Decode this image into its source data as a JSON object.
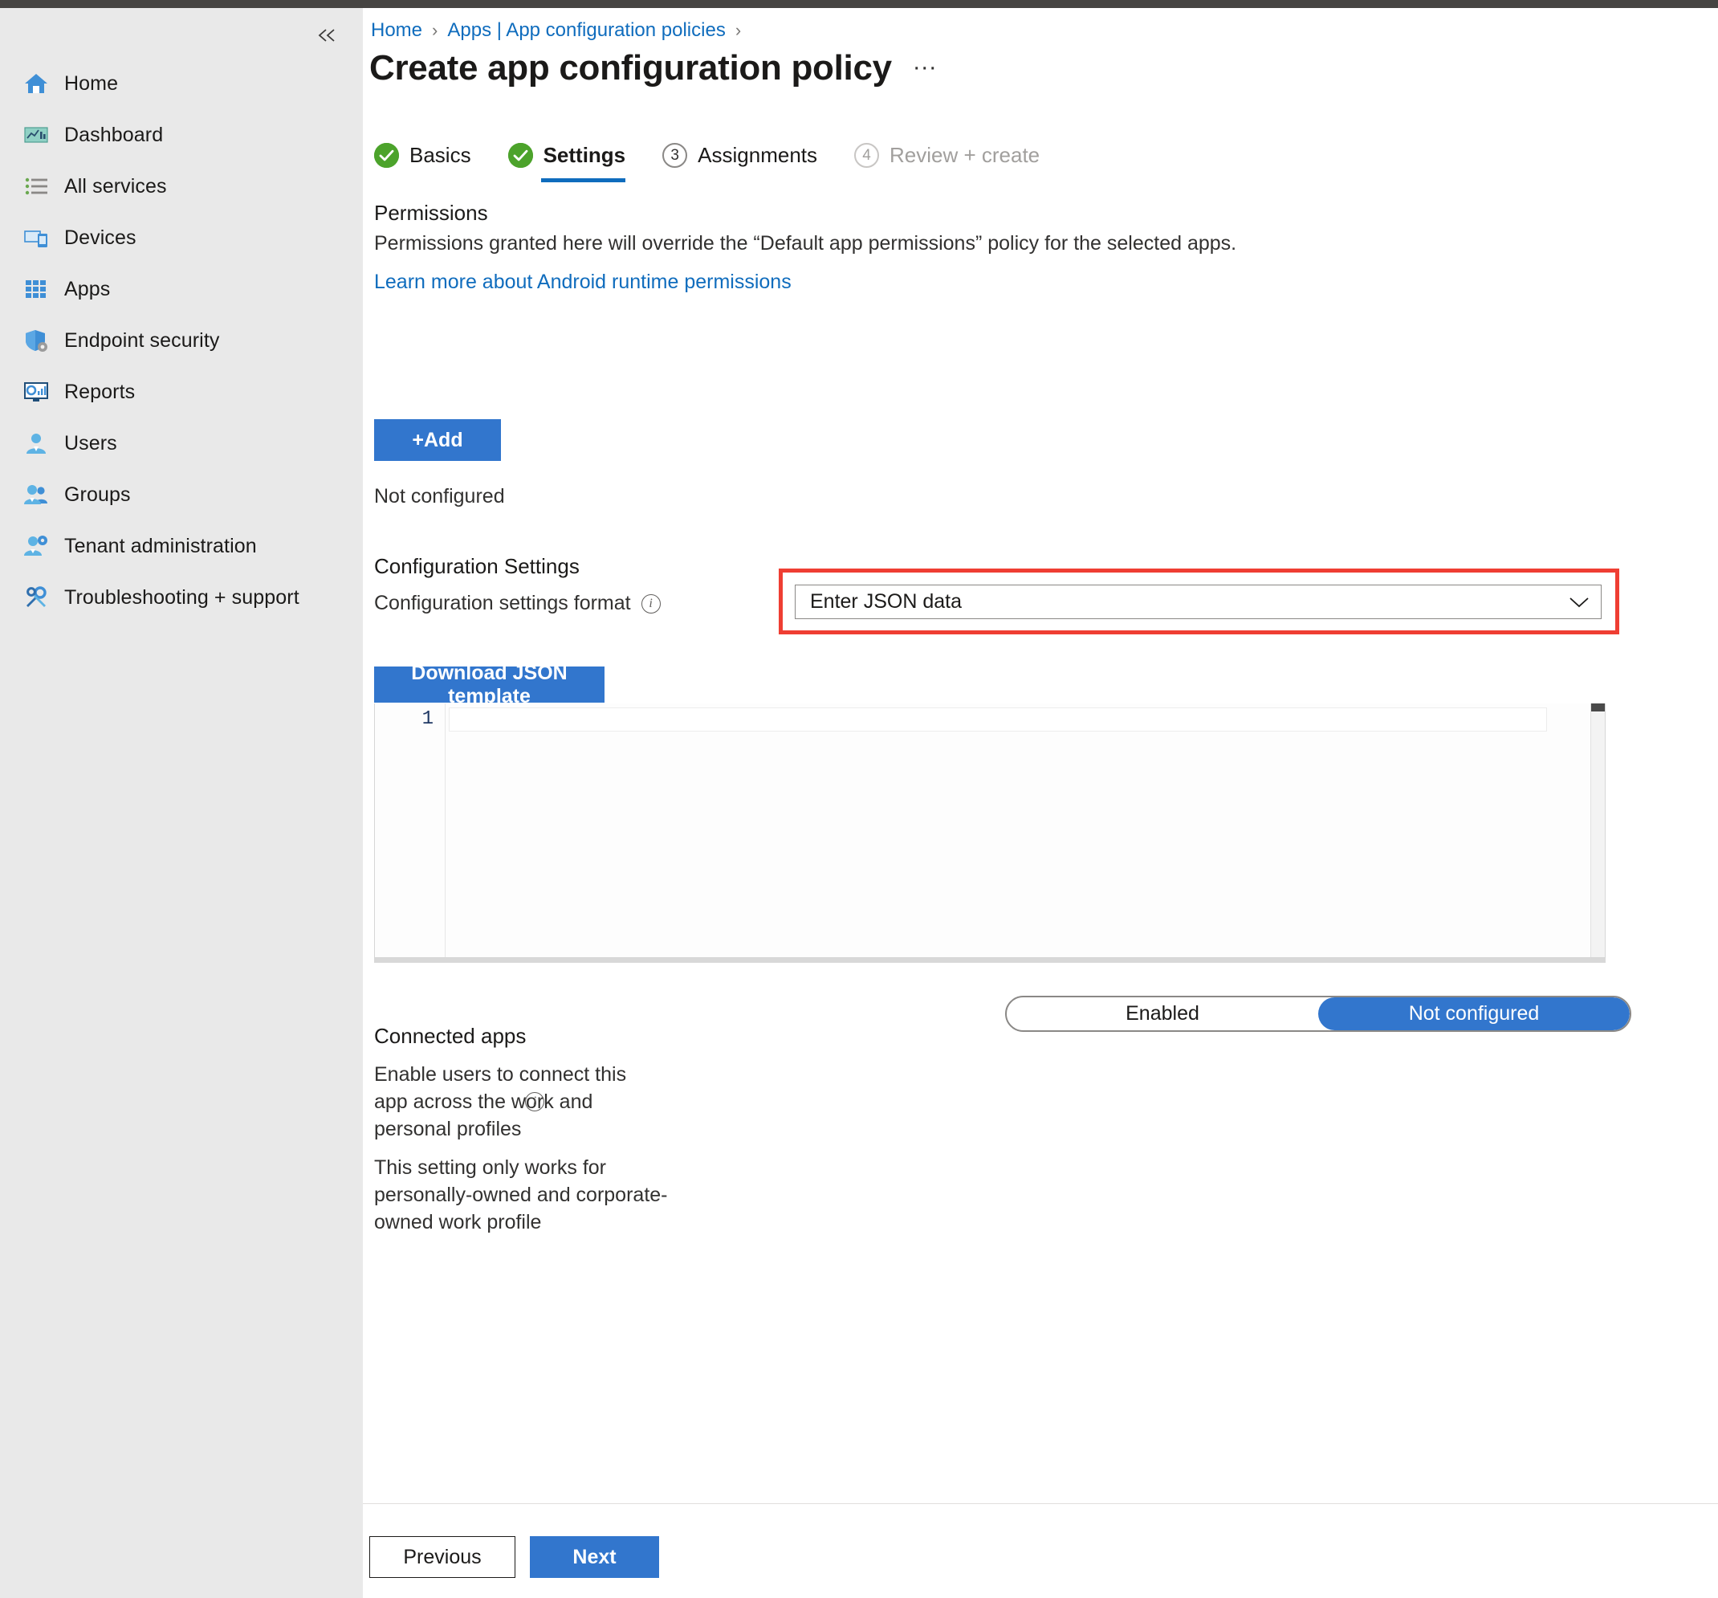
{
  "sidebar": {
    "collapse_label": "«",
    "items": [
      {
        "label": "Home",
        "icon": "home-icon"
      },
      {
        "label": "Dashboard",
        "icon": "dashboard-icon"
      },
      {
        "label": "All services",
        "icon": "all-services-icon"
      },
      {
        "label": "Devices",
        "icon": "devices-icon"
      },
      {
        "label": "Apps",
        "icon": "apps-grid-icon"
      },
      {
        "label": "Endpoint security",
        "icon": "shield-gear-icon"
      },
      {
        "label": "Reports",
        "icon": "reports-monitor-icon"
      },
      {
        "label": "Users",
        "icon": "user-icon"
      },
      {
        "label": "Groups",
        "icon": "groups-icon"
      },
      {
        "label": "Tenant administration",
        "icon": "tenant-admin-icon"
      },
      {
        "label": "Troubleshooting + support",
        "icon": "wrench-screwdriver-icon"
      }
    ]
  },
  "breadcrumb": {
    "items": [
      "Home",
      "Apps | App configuration policies"
    ],
    "separator": "›"
  },
  "header": {
    "title": "Create app configuration policy",
    "more_label": "···"
  },
  "wizard": {
    "steps": [
      {
        "label": "Basics",
        "marker": "✓",
        "state": "done"
      },
      {
        "label": "Settings",
        "marker": "✓",
        "state": "active"
      },
      {
        "label": "Assignments",
        "marker": "3",
        "state": "upcoming"
      },
      {
        "label": "Review + create",
        "marker": "4",
        "state": "disabled"
      }
    ]
  },
  "permissions": {
    "heading": "Permissions",
    "description": "Permissions granted here will override the “Default app permissions” policy for the selected apps.",
    "learn_more": "Learn more about Android runtime permissions",
    "add_button": "+Add",
    "status": "Not configured"
  },
  "configuration_settings": {
    "heading": "Configuration Settings",
    "format_label": "Configuration settings format",
    "format_info": "i",
    "format_value": "Enter JSON data",
    "dropdown_chevron": "chevron-down-icon",
    "download_button": "Download JSON template",
    "editor": {
      "line_numbers": [
        "1"
      ],
      "content": ""
    },
    "highlight_color": "#ef3e33"
  },
  "connected_apps": {
    "heading": "Connected apps",
    "description": "Enable users to connect this app across the work and personal profiles",
    "info": "i",
    "note": "This setting only works for personally-owned and corporate-owned work profile",
    "toggle": {
      "options": [
        "Enabled",
        "Not configured"
      ],
      "selected": "Not configured"
    }
  },
  "footer": {
    "previous": "Previous",
    "next": "Next"
  },
  "colors": {
    "accent": "#3276cd",
    "link": "#0f6cbd",
    "success": "#4ca32b",
    "highlight": "#ef3e33",
    "chrome": "#464442",
    "sidebar_bg": "#e9e9e9"
  }
}
